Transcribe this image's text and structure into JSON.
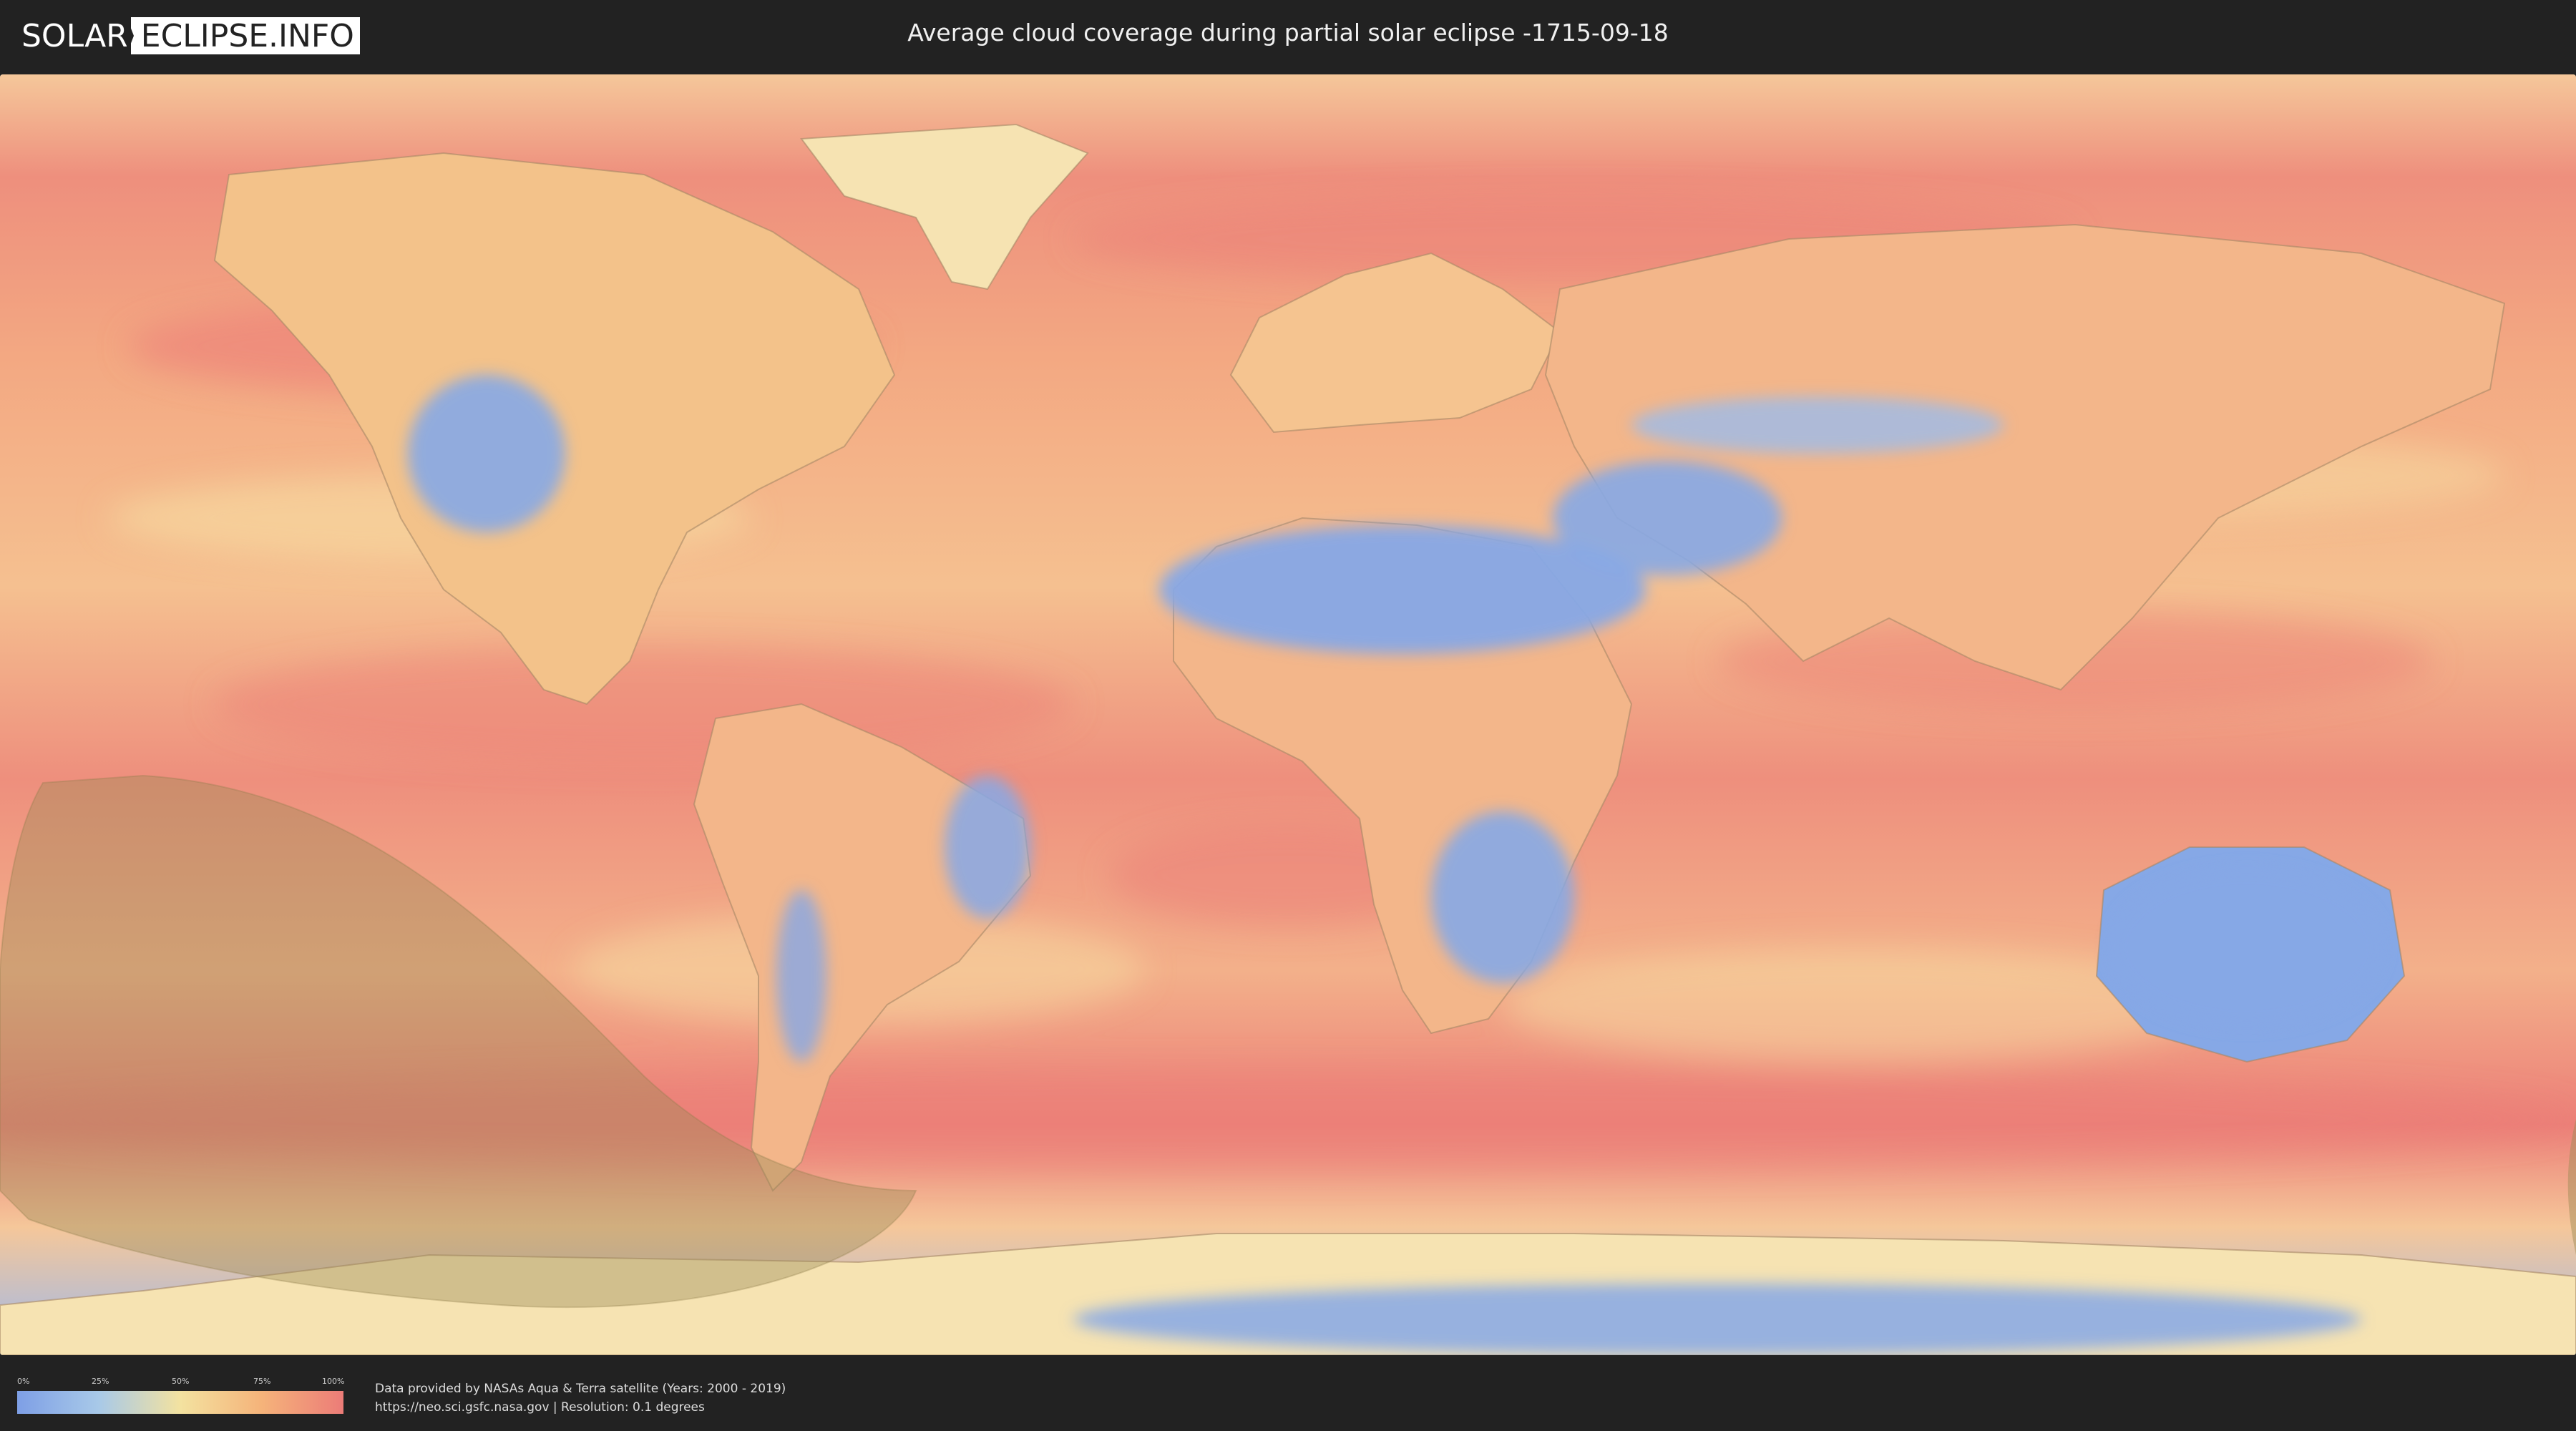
{
  "header": {
    "logo_left": "SOLAR",
    "logo_right": "ECLIPSE.INFO",
    "title": "Average cloud coverage during partial solar eclipse -1715-09-18"
  },
  "legend": {
    "ticks": [
      "0%",
      "25%",
      "50%",
      "75%",
      "100%"
    ],
    "colors": [
      "#7e9fe6",
      "#a8c9e8",
      "#f3e2a0",
      "#f5b37a",
      "#ec7c78"
    ]
  },
  "credits": {
    "line1": "Data provided by NASAs Aqua & Terra satellite (Years: 2000 - 2019)",
    "line2": "https://neo.sci.gsfc.nasa.gov | Resolution: 0.1 degrees"
  },
  "map": {
    "ocean_color": "#f2a37e",
    "land_color": "#f3d49a",
    "clear_color": "#86a8e6",
    "cloudy_color": "#ec7f78",
    "eclipse_overlay_color": "#9b8a55"
  }
}
